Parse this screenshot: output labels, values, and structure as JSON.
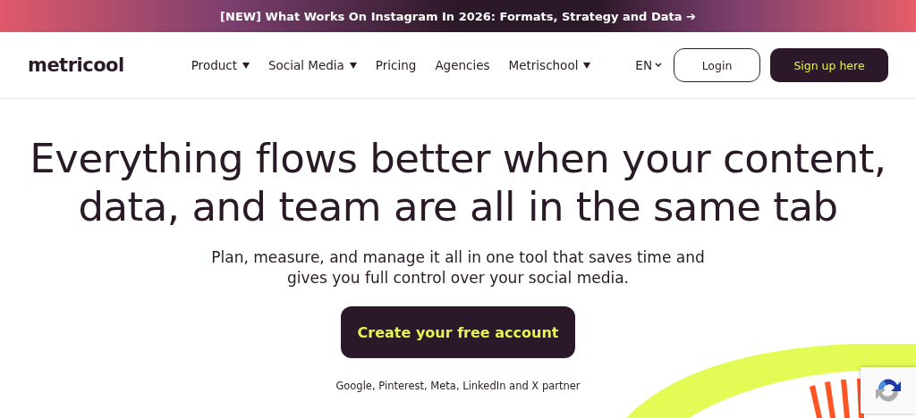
{
  "announcement": {
    "text": "[NEW] What Works On Instagram In 2026: Formats, Strategy and Data ➔"
  },
  "header": {
    "logo": "metricool",
    "nav": [
      {
        "label": "Product",
        "has_menu": true
      },
      {
        "label": "Social Media",
        "has_menu": true
      },
      {
        "label": "Pricing",
        "has_menu": false
      },
      {
        "label": "Agencies",
        "has_menu": false
      },
      {
        "label": "Metrischool",
        "has_menu": true
      }
    ],
    "language": "EN",
    "login": "Login",
    "signup": "Sign up here"
  },
  "hero": {
    "title": "Everything flows better when your content, data, and team are all in the same tab",
    "subtitle": "Plan, measure, and manage it all in one tool that saves time and gives you full control over your social media.",
    "cta": "Create your free account",
    "partners": "Google, Pinterest, Meta, LinkedIn and X partner"
  }
}
